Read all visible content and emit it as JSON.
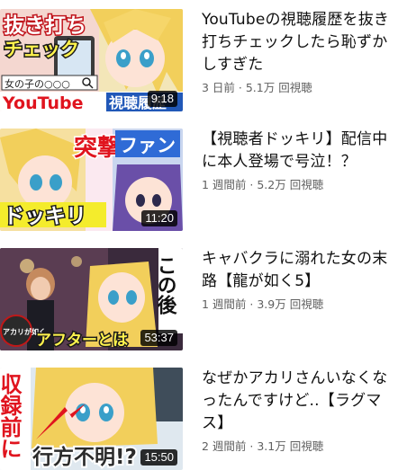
{
  "videos": [
    {
      "title": "YouTubeの視聴履歴を抜き打ちチェックしたら恥ずかしすぎた",
      "meta": "3 日前 · 5.1万 回視聴",
      "duration": "9:18",
      "thumb_text": {
        "top": "抜き打ち",
        "mid": "チェック",
        "search": "女の子の○○○",
        "banner_a": "YouTube",
        "banner_b": "視聴履歴"
      }
    },
    {
      "title": "【視聴者ドッキリ】配信中に本人登場で号泣！？",
      "meta": "1 週間前 · 5.2万 回視聴",
      "duration": "11:20",
      "thumb_text": {
        "a": "突撃",
        "b": "ファン",
        "c": "ドッキリ"
      }
    },
    {
      "title": "キャバクラに溺れた女の末路【龍が如く5】",
      "meta": "1 週間前 · 3.9万 回視聴",
      "duration": "53:37",
      "thumb_text": {
        "a": "この後",
        "b": "アカリが如く",
        "c": "アフターとは"
      }
    },
    {
      "title": "なぜかアカリさんいなくなったんですけど..【ラグマス】",
      "meta": "2 週間前 · 3.1万 回視聴",
      "duration": "15:50",
      "thumb_text": {
        "a": "収録前に",
        "b": "行方不明!?"
      }
    }
  ]
}
